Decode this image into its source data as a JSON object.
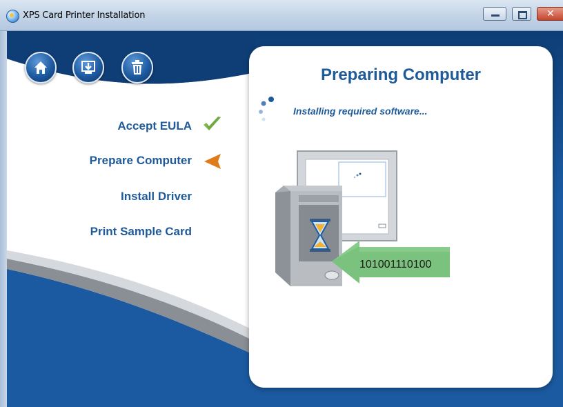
{
  "window": {
    "title": "XPS Card Printer Installation",
    "app_icon": "printer-cd-icon",
    "controls": {
      "minimize": "minimize-icon",
      "maximize": "maximize-icon",
      "close": "close-icon"
    }
  },
  "nav_buttons": [
    {
      "name": "home",
      "icon": "home-icon"
    },
    {
      "name": "install",
      "icon": "download-install-icon"
    },
    {
      "name": "uninstall",
      "icon": "trash-icon"
    }
  ],
  "steps": [
    {
      "label": "Accept EULA",
      "state": "complete",
      "indicator": "checkmark-icon"
    },
    {
      "label": "Prepare Computer",
      "state": "current",
      "indicator": "arrow-left-icon"
    },
    {
      "label": "Install Driver",
      "state": "pending"
    },
    {
      "label": "Print Sample Card",
      "state": "pending"
    }
  ],
  "panel": {
    "title": "Preparing Computer",
    "status": "Installing required software...",
    "illustration": {
      "binary": "101001110100",
      "icons": [
        "computer-monitor-icon",
        "computer-tower-icon",
        "hourglass-icon",
        "green-arrow-icon",
        "spinner-dots-icon"
      ]
    }
  },
  "colors": {
    "accent_blue": "#1f5a99",
    "background_dark_blue": "#0f3e76",
    "check_green": "#7fb84f",
    "current_orange": "#e07b1a",
    "arrow_green": "#7bc27e"
  }
}
